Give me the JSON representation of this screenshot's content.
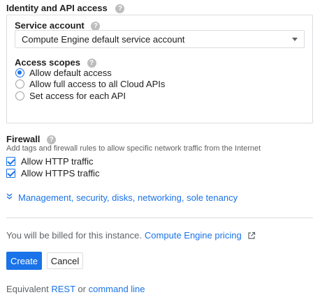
{
  "identity": {
    "heading": "Identity and API access",
    "service_account": {
      "label": "Service account",
      "selected": "Compute Engine default service account"
    },
    "access_scopes": {
      "label": "Access scopes",
      "options": [
        {
          "label": "Allow default access",
          "checked": true
        },
        {
          "label": "Allow full access to all Cloud APIs",
          "checked": false
        },
        {
          "label": "Set access for each API",
          "checked": false
        }
      ]
    }
  },
  "firewall": {
    "heading": "Firewall",
    "description": "Add tags and firewall rules to allow specific network traffic from the Internet",
    "options": [
      {
        "label": "Allow HTTP traffic",
        "checked": true
      },
      {
        "label": "Allow HTTPS traffic",
        "checked": true
      }
    ]
  },
  "management_link": "Management, security, disks, networking, sole tenancy",
  "billing": {
    "text": "You will be billed for this instance.",
    "link": "Compute Engine pricing"
  },
  "actions": {
    "create": "Create",
    "cancel": "Cancel"
  },
  "equivalent": {
    "prefix": "Equivalent",
    "rest": "REST",
    "or": "or",
    "command_line": "command line"
  },
  "colors": {
    "accent": "#1a73e8",
    "border": "#dadce0"
  }
}
